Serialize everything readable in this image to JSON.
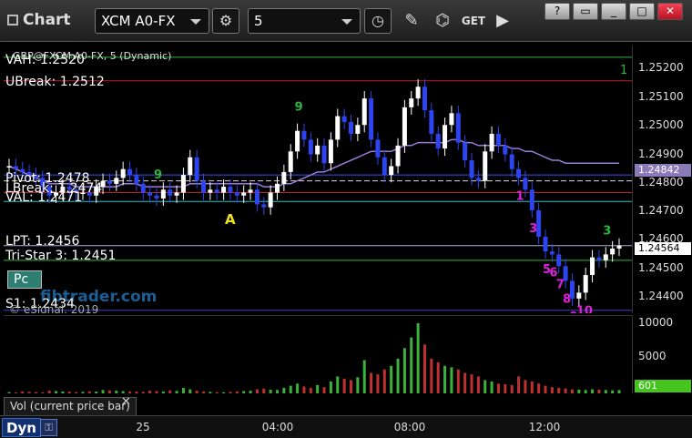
{
  "toolbar": {
    "app_title": "Chart",
    "symbol": "XCM A0-FX",
    "interval": "5",
    "icons": [
      "settings-gear-icon",
      "clock-icon",
      "pencil-icon",
      "study-icon",
      "get-icon",
      "play-icon"
    ]
  },
  "price_panel": {
    "symbol_line": "GBP@FXCM A0-FX, 5 (Dynamic)",
    "labels": {
      "vah": "VAH: 1.2520",
      "ubreak": "UBreak: 1.2512",
      "pivot": "Pivot: 1.2478",
      "lbreak": "LBreak: 1.2474",
      "val": "VAL: 1.2471",
      "lpt": "LPT: 1.2456",
      "tristar": "Tri-Star 3: 1.2451",
      "s1": "S1: 1.2434"
    },
    "pc_label": "Pc",
    "watermark": "fibtrader.com",
    "copyright": "© eSignal, 2019",
    "marker_a": "A",
    "axis": {
      "ticks": [
        "1.25200",
        "1.25100",
        "1.25000",
        "1.24900",
        "1.24800",
        "1.24700",
        "1.24600",
        "1.24500",
        "1.24400"
      ],
      "badge_ma": "1.24842",
      "badge_last": "1.24564",
      "corner_green": "1"
    }
  },
  "volume_panel": {
    "caption": "Vol (current price bar)",
    "close_label": "✕",
    "axis_ticks": [
      "10000",
      "5000",
      "0"
    ],
    "badge": "601"
  },
  "time_axis": {
    "mode_label": "Dyn",
    "labels": [
      "25",
      "04:00",
      "08:00",
      "12:00"
    ]
  },
  "chart_data": {
    "type": "candlestick",
    "y_range": [
      1.2433,
      1.2524
    ],
    "levels": [
      {
        "name": "VAH",
        "value": 1.252,
        "color": "#2db83a"
      },
      {
        "name": "UBreak",
        "value": 1.2512,
        "color": "#c0202a"
      },
      {
        "name": "Pivot",
        "value": 1.2478,
        "color": "#d8d8d8"
      },
      {
        "name": "LBreak",
        "value": 1.2474,
        "color": "#c0202a"
      },
      {
        "name": "VAL",
        "value": 1.2471,
        "color": "#35c0c0"
      },
      {
        "name": "LPT",
        "value": 1.2456,
        "color": "#b0b0d8"
      },
      {
        "name": "Tri-Star 3",
        "value": 1.2451,
        "color": "#2db83a"
      },
      {
        "name": "S1",
        "value": 1.2434,
        "color": "#3c3cc8"
      }
    ],
    "closes": [
      1.2483,
      1.2482,
      1.2481,
      1.248,
      1.2479,
      1.2476,
      1.2473,
      1.2474,
      1.2476,
      1.2475,
      1.2474,
      1.2474,
      1.2473,
      1.2476,
      1.2478,
      1.2477,
      1.2479,
      1.2482,
      1.248,
      1.2477,
      1.2474,
      1.2473,
      1.2472,
      1.2475,
      1.2473,
      1.2474,
      1.248,
      1.2486,
      1.2478,
      1.2474,
      1.2475,
      1.2474,
      1.2476,
      1.2474,
      1.2473,
      1.2474,
      1.2475,
      1.247,
      1.2469,
      1.2474,
      1.2477,
      1.2481,
      1.2488,
      1.2495,
      1.2492,
      1.2487,
      1.249,
      1.2484,
      1.2492,
      1.25,
      1.2498,
      1.2494,
      1.2497,
      1.2506,
      1.2492,
      1.2486,
      1.248,
      1.2483,
      1.249,
      1.2503,
      1.2506,
      1.251,
      1.2502,
      1.2494,
      1.2489,
      1.2497,
      1.2501,
      1.2491,
      1.2485,
      1.2479,
      1.2478,
      1.2488,
      1.2494,
      1.249,
      1.2487,
      1.2482,
      1.2479,
      1.2475,
      1.2468,
      1.2459,
      1.2454,
      1.2453,
      1.2449,
      1.2444,
      1.2438,
      1.244,
      1.2446,
      1.2452,
      1.2451,
      1.2453,
      1.2455,
      1.2456
    ],
    "ma": [
      1.2483,
      1.2482,
      1.2481,
      1.248,
      1.2479,
      1.2478,
      1.2477,
      1.2477,
      1.2477,
      1.2477,
      1.2476,
      1.2476,
      1.2476,
      1.2476,
      1.2476,
      1.2476,
      1.2476,
      1.2477,
      1.2477,
      1.2477,
      1.2476,
      1.2476,
      1.2476,
      1.2476,
      1.2476,
      1.2476,
      1.2476,
      1.2477,
      1.2477,
      1.2477,
      1.2477,
      1.2477,
      1.2477,
      1.2477,
      1.2477,
      1.2477,
      1.2477,
      1.2477,
      1.2476,
      1.2476,
      1.2476,
      1.2477,
      1.2477,
      1.2478,
      1.2479,
      1.248,
      1.2481,
      1.2481,
      1.2482,
      1.2483,
      1.2484,
      1.2485,
      1.2486,
      1.2487,
      1.2488,
      1.2488,
      1.2488,
      1.2488,
      1.2489,
      1.249,
      1.249,
      1.2491,
      1.2491,
      1.2491,
      1.2491,
      1.2491,
      1.2492,
      1.2492,
      1.2491,
      1.2491,
      1.249,
      1.249,
      1.249,
      1.249,
      1.249,
      1.2489,
      1.2489,
      1.2488,
      1.2488,
      1.2487,
      1.2486,
      1.2485,
      1.2485,
      1.2484,
      1.2484,
      1.2484,
      1.2484,
      1.2484,
      1.2484,
      1.2484,
      1.2484,
      1.2484
    ],
    "volume": [
      300,
      250,
      400,
      350,
      300,
      280,
      500,
      450,
      400,
      380,
      300,
      350,
      420,
      380,
      600,
      550,
      500,
      450,
      400,
      380,
      350,
      500,
      450,
      400,
      550,
      480,
      900,
      700,
      500,
      400,
      350,
      300,
      280,
      350,
      400,
      450,
      500,
      700,
      800,
      650,
      600,
      900,
      1200,
      1500,
      1100,
      900,
      1300,
      1000,
      1800,
      2500,
      2200,
      2000,
      2400,
      4800,
      3000,
      2800,
      3500,
      4000,
      5000,
      6500,
      8000,
      10000,
      7000,
      5000,
      4500,
      4000,
      3800,
      3500,
      3000,
      2800,
      2500,
      2000,
      1800,
      1500,
      1400,
      1300,
      2500,
      2000,
      1800,
      1500,
      1200,
      1000,
      900,
      800,
      700,
      650,
      600,
      700,
      650,
      601,
      550,
      601
    ],
    "volume_max": 10500,
    "setup_counts": [
      {
        "label": "9",
        "color": "#2db83a",
        "bar": 22
      },
      {
        "label": "9",
        "color": "#2db83a",
        "bar": 43
      },
      {
        "label": "1",
        "color": "#e020e0",
        "bar": 76
      },
      {
        "label": "3",
        "color": "#e020e0",
        "bar": 78
      },
      {
        "label": "5",
        "color": "#e020e0",
        "bar": 80
      },
      {
        "label": "6",
        "color": "#e020e0",
        "bar": 81
      },
      {
        "label": "7",
        "color": "#e020e0",
        "bar": 82
      },
      {
        "label": "8",
        "color": "#e020e0",
        "bar": 83
      },
      {
        "label": "9",
        "color": "#e020e0",
        "bar": 84
      },
      {
        "label": "10",
        "color": "#e020e0",
        "bar": 85
      },
      {
        "label": "3",
        "color": "#2db83a",
        "bar": 89
      }
    ]
  }
}
